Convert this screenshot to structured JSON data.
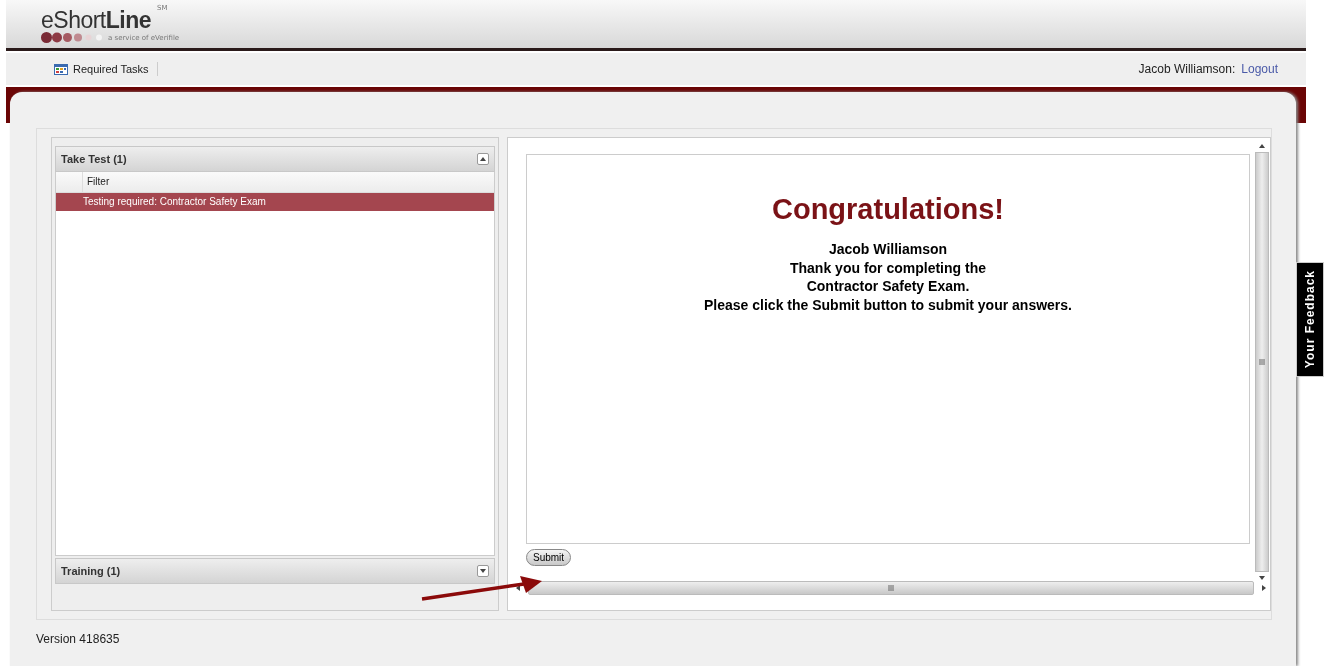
{
  "header": {
    "logo": {
      "prefix": "eShort",
      "bold": "Line",
      "mark": "SM",
      "tagline": "a service of eVerifile"
    }
  },
  "toolbar": {
    "items": [
      {
        "label": "Required Tasks"
      }
    ],
    "user": "Jacob Williamson:",
    "logout": "Logout"
  },
  "sections": [
    {
      "title": "Take Test (1)",
      "expanded": true,
      "filter": "Filter",
      "rows": [
        {
          "label": "Testing required: Contractor Safety Exam",
          "selected": true
        }
      ]
    },
    {
      "title": "Training (1)",
      "expanded": false
    }
  ],
  "content": {
    "heading": "Congratulations!",
    "lines": [
      "Jacob Williamson",
      "Thank you for completing the",
      "Contractor Safety Exam.",
      "Please click the Submit button to submit your answers."
    ],
    "submit": "Submit"
  },
  "feedback": "Your Feedback",
  "version": "Version 418635"
}
